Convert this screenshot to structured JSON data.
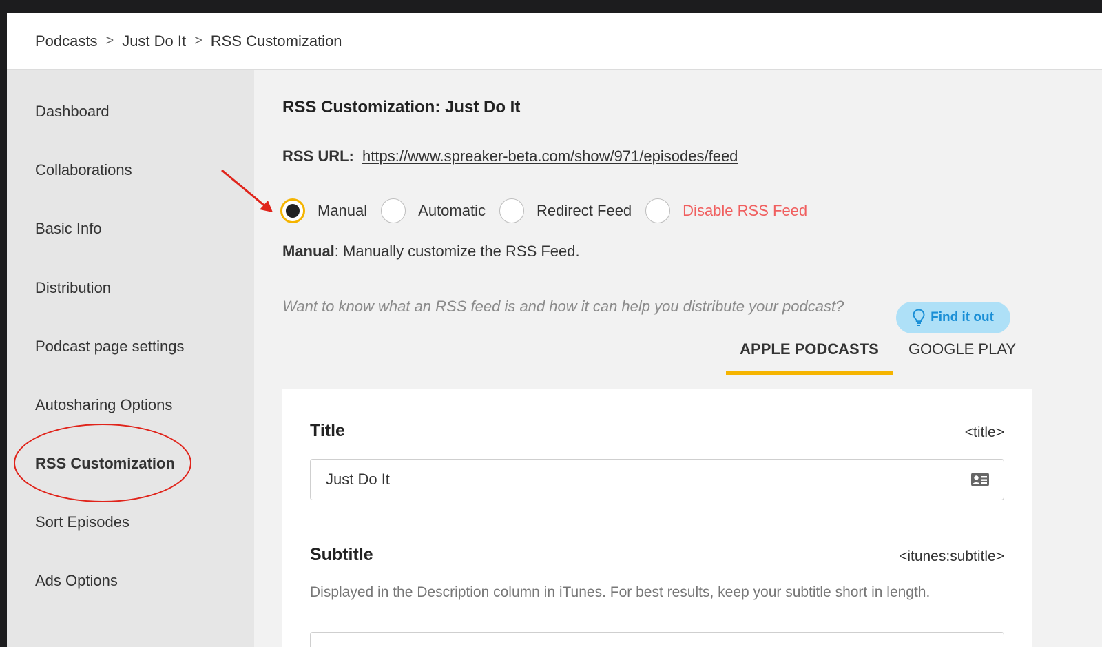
{
  "breadcrumb": {
    "items": [
      "Podcasts",
      "Just Do It",
      "RSS Customization"
    ],
    "separator": ">"
  },
  "sidebar": {
    "items": [
      {
        "label": "Dashboard"
      },
      {
        "label": "Collaborations"
      },
      {
        "label": "Basic Info"
      },
      {
        "label": "Distribution"
      },
      {
        "label": "Podcast page settings"
      },
      {
        "label": "Autosharing Options"
      },
      {
        "label": "RSS Customization",
        "active": true
      },
      {
        "label": "Sort Episodes"
      },
      {
        "label": "Ads Options"
      }
    ]
  },
  "main": {
    "title": "RSS Customization: Just Do It",
    "rss_url_label": "RSS URL:",
    "rss_url": "https://www.spreaker-beta.com/show/971/episodes/feed",
    "modes": [
      {
        "label": "Manual",
        "selected": true
      },
      {
        "label": "Automatic",
        "selected": false
      },
      {
        "label": "Redirect Feed",
        "selected": false
      },
      {
        "label": "Disable RSS Feed",
        "selected": false,
        "danger": true
      }
    ],
    "mode_desc_label": "Manual",
    "mode_desc_text": ":  Manually customize the RSS Feed.",
    "hint": "Want to know what an RSS feed is and how it can help you distribute your podcast?",
    "find_button": "Find it out",
    "tabs": [
      {
        "label": "APPLE PODCASTS",
        "active": true
      },
      {
        "label": "GOOGLE PLAY",
        "active": false
      }
    ],
    "fields": {
      "title": {
        "label": "Title",
        "tag": "<title>",
        "value": "Just Do It"
      },
      "subtitle": {
        "label": "Subtitle",
        "tag": "<itunes:subtitle>",
        "help": "Displayed in the Description column in iTunes. For best results, keep your subtitle short in length."
      }
    }
  },
  "colors": {
    "accent": "#f5b400",
    "danger": "#f05f5f",
    "info_bg": "#aee0f7",
    "info_text": "#1a8fd6",
    "annotation": "#e0241b"
  }
}
